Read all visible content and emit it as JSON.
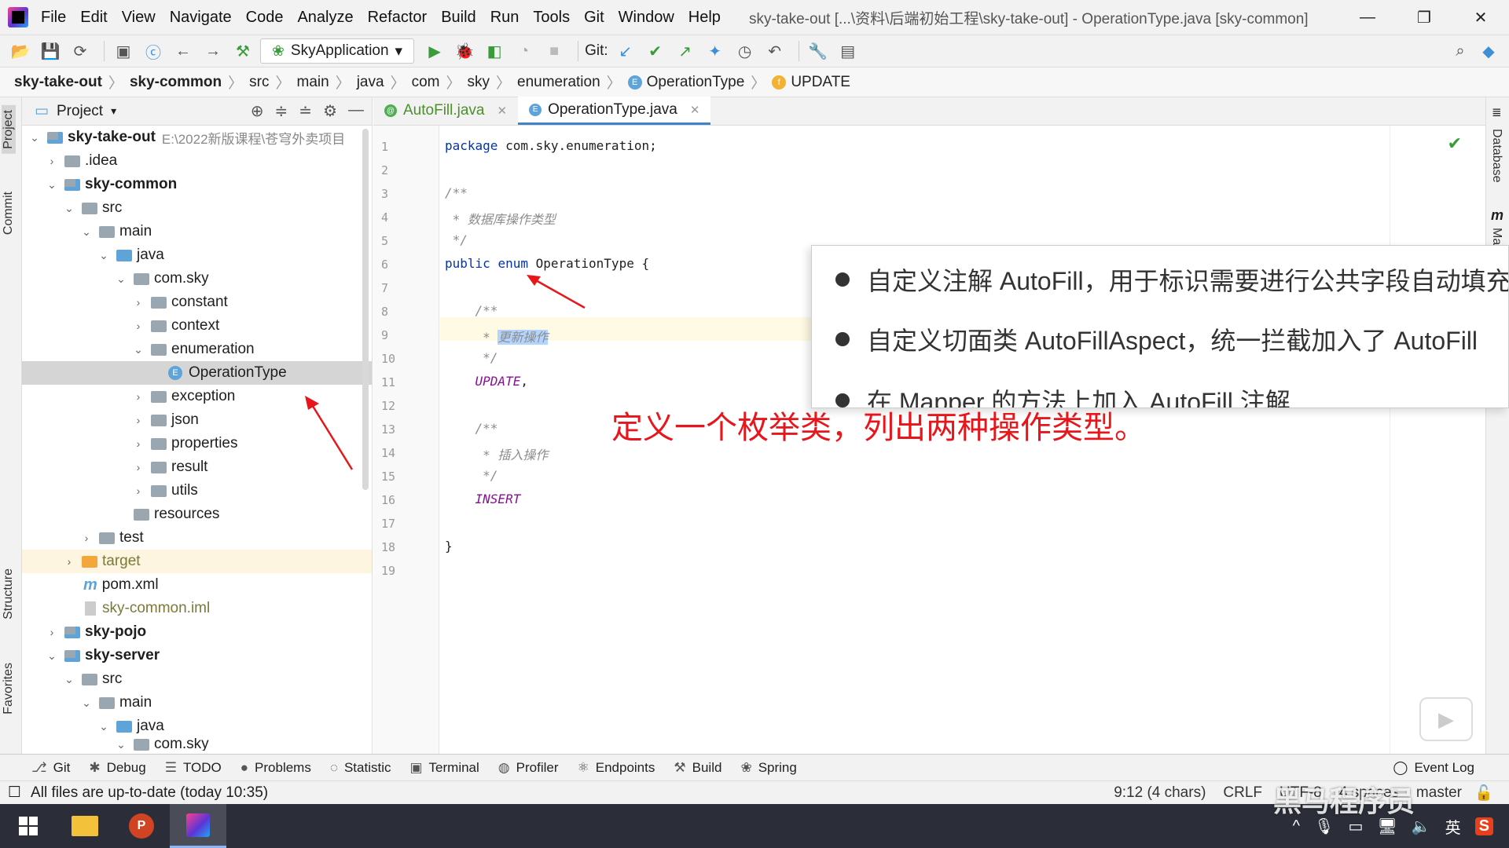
{
  "titlebar": {
    "menus": [
      "File",
      "Edit",
      "View",
      "Navigate",
      "Code",
      "Analyze",
      "Refactor",
      "Build",
      "Run",
      "Tools",
      "Git",
      "Window",
      "Help"
    ],
    "window_title": "sky-take-out [...\\资料\\后端初始工程\\sky-take-out] - OperationType.java [sky-common]"
  },
  "toolbar": {
    "run_config": "SkyApplication",
    "git_label": "Git:"
  },
  "breadcrumb": [
    "sky-take-out",
    "sky-common",
    "src",
    "main",
    "java",
    "com",
    "sky",
    "enumeration",
    "OperationType",
    "UPDATE"
  ],
  "left_strip": {
    "tabs": [
      "Project",
      "Commit",
      "Structure",
      "Favorites"
    ]
  },
  "right_strip": {
    "tabs": [
      "Database",
      "Ma"
    ]
  },
  "project_panel": {
    "title": "Project",
    "rows": [
      {
        "label": "sky-take-out",
        "extra": "E:\\2022新版课程\\苍穹外卖项目"
      },
      {
        "label": ".idea"
      },
      {
        "label": "sky-common"
      },
      {
        "label": "src"
      },
      {
        "label": "main"
      },
      {
        "label": "java"
      },
      {
        "label": "com.sky"
      },
      {
        "label": "constant"
      },
      {
        "label": "context"
      },
      {
        "label": "enumeration"
      },
      {
        "label": "OperationType"
      },
      {
        "label": "exception"
      },
      {
        "label": "json"
      },
      {
        "label": "properties"
      },
      {
        "label": "result"
      },
      {
        "label": "utils"
      },
      {
        "label": "resources"
      },
      {
        "label": "test"
      },
      {
        "label": "target"
      },
      {
        "label": "pom.xml"
      },
      {
        "label": "sky-common.iml"
      },
      {
        "label": "sky-pojo"
      },
      {
        "label": "sky-server"
      },
      {
        "label": "src"
      },
      {
        "label": "main"
      },
      {
        "label": "java"
      },
      {
        "label": "com.sky"
      }
    ]
  },
  "editor": {
    "tabs": [
      {
        "label": "AutoFill.java",
        "icon": "@"
      },
      {
        "label": "OperationType.java",
        "icon": "E"
      }
    ],
    "line_numbers": [
      "1",
      "2",
      "3",
      "4",
      "5",
      "6",
      "7",
      "8",
      "9",
      "10",
      "11",
      "12",
      "13",
      "14",
      "15",
      "16",
      "17",
      "18",
      "19"
    ],
    "code": {
      "l1_kw": "package",
      "l1_rest": " com.sky.enumeration;",
      "l3": "/**",
      "l4": " * 数据库操作类型",
      "l5": " */",
      "l6_kw1": "public",
      "l6_kw2": "enum",
      "l6_rest": " OperationType {",
      "l8": "    /**",
      "l9_prefix": "     * ",
      "l9_sel": "更新操作",
      "l10": "     */",
      "l11_const": "    UPDATE",
      "l11_rest": ",",
      "l13": "    /**",
      "l14": "     * 插入操作",
      "l15": "     */",
      "l16_const": "    INSERT",
      "l18": "}"
    }
  },
  "overlay": {
    "bullets": [
      "自定义注解 AutoFill，用于标识需要进行公共字段自动填充",
      "自定义切面类 AutoFillAspect，统一拦截加入了 AutoFill",
      "在 Mapper 的方法上加入 AutoFill 注解"
    ],
    "annotation": "定义一个枚举类，列出两种操作类型。"
  },
  "bottom_tabs": [
    "Git",
    "Debug",
    "TODO",
    "Problems",
    "Statistic",
    "Terminal",
    "Profiler",
    "Endpoints",
    "Build",
    "Spring"
  ],
  "event_log": "Event Log",
  "status": {
    "message": "All files are up-to-date (today 10:35)",
    "position": "9:12 (4 chars)",
    "line_sep": "CRLF",
    "encoding": "UTF-8",
    "indent": "4 spaces",
    "branch": "master"
  },
  "watermark": "黑马程序员",
  "tray": {
    "ime": "英"
  }
}
